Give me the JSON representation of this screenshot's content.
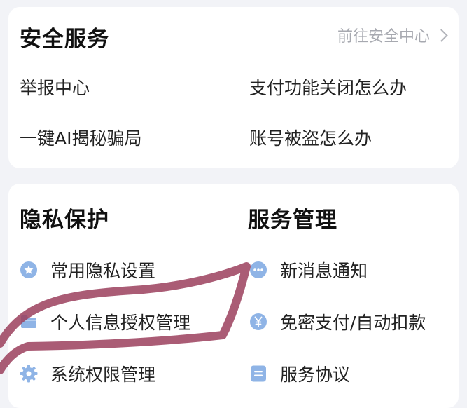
{
  "security": {
    "title": "安全服务",
    "center_link": "前往安全中心",
    "items": [
      {
        "label": "举报中心"
      },
      {
        "label": "支付功能关闭怎么办"
      },
      {
        "label": "一键AI揭秘骗局"
      },
      {
        "label": "账号被盗怎么办"
      }
    ]
  },
  "privacy": {
    "title": "隐私保护",
    "items": [
      {
        "label": "常用隐私设置",
        "icon": "star-badge-icon"
      },
      {
        "label": "个人信息授权管理",
        "icon": "folder-icon"
      },
      {
        "label": "系统权限管理",
        "icon": "gear-icon"
      }
    ]
  },
  "service": {
    "title": "服务管理",
    "items": [
      {
        "label": "新消息通知",
        "icon": "chat-bubble-icon"
      },
      {
        "label": "免密支付/自动扣款",
        "icon": "yen-icon"
      },
      {
        "label": "服务协议",
        "icon": "document-icon"
      }
    ]
  },
  "colors": {
    "background": "#f2f3f7",
    "card": "#ffffff",
    "icon_blue": "#8fb4e6",
    "annotation": "#9b3f5d"
  }
}
